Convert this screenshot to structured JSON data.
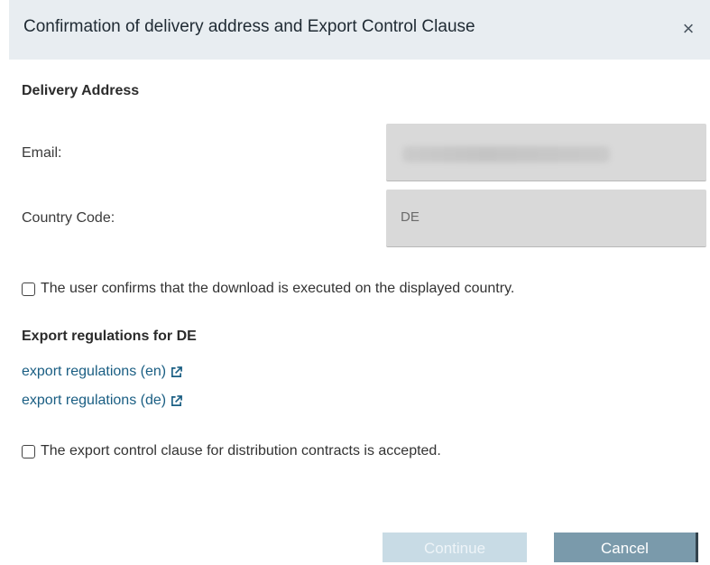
{
  "dialog": {
    "title": "Confirmation of delivery address and Export Control Clause",
    "close_icon": "×"
  },
  "delivery": {
    "heading": "Delivery Address",
    "email_label": "Email:",
    "email_value": "",
    "country_label": "Country Code:",
    "country_value": "DE"
  },
  "confirm_country": {
    "label": "The user confirms that the download is executed on the displayed country.",
    "checked": false
  },
  "export": {
    "heading": "Export regulations for DE",
    "links": [
      {
        "label": "export regulations (en)",
        "icon": "external-link-icon"
      },
      {
        "label": "export regulations (de)",
        "icon": "external-link-icon"
      }
    ]
  },
  "confirm_export": {
    "label": "The export control clause for distribution contracts is accepted.",
    "checked": false
  },
  "buttons": {
    "continue": "Continue",
    "cancel": "Cancel"
  },
  "colors": {
    "header_bg": "#e8edf1",
    "link": "#1a5e83",
    "continue_disabled": "#c8dbe5",
    "cancel": "#7a9aab"
  }
}
